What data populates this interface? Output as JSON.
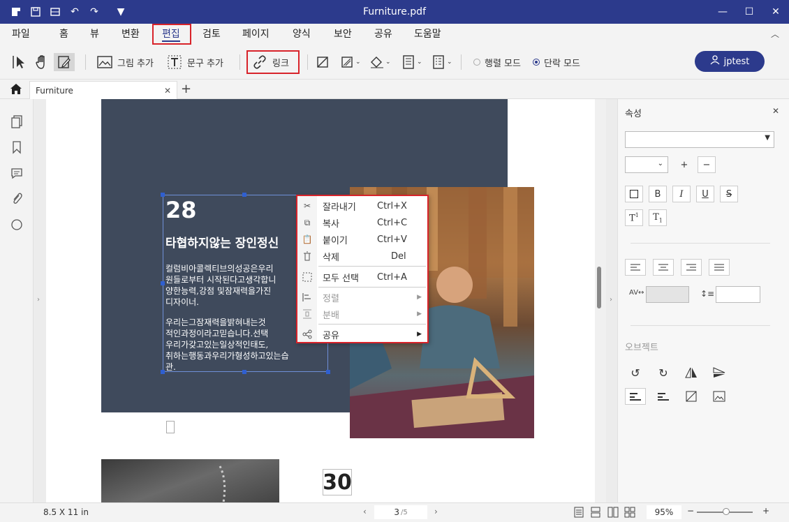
{
  "window": {
    "title": "Furniture.pdf"
  },
  "menu": [
    "파일",
    "홈",
    "뷰",
    "변환",
    "편집",
    "검토",
    "페이지",
    "양식",
    "보안",
    "공유",
    "도움말"
  ],
  "toolbar": {
    "add_image": "그림 추가",
    "add_text": "문구 추가",
    "link": "링크",
    "line_mode": "행렬 모드",
    "para_mode": "단락 모드",
    "user": "jptest"
  },
  "tab": {
    "name": "Furniture"
  },
  "doc": {
    "number1": "28",
    "heading": "타협하지않는 장인정신",
    "para1": [
      "컬럼비아콜렉티브의성공은우리",
      "원들로부터 시작된다고생각합니",
      "양한능력,강점 및잠재력을가진",
      "디자이너."
    ],
    "para2": [
      "우리는그잠재력을밝혀내는것",
      "적인과정이라고믿습니다.선택",
      "우리가갖고있는일상적인태도,",
      "취하는행동과우리가형성하고있는습",
      "관."
    ],
    "number2": "30"
  },
  "context_menu": [
    {
      "label": "잘라내기",
      "shortcut": "Ctrl+X",
      "icon": "scissors-icon"
    },
    {
      "label": "복사",
      "shortcut": "Ctrl+C",
      "icon": "copy-icon"
    },
    {
      "label": "붙이기",
      "shortcut": "Ctrl+V",
      "icon": "paste-icon"
    },
    {
      "label": "삭제",
      "shortcut": "Del",
      "icon": "trash-icon"
    },
    {
      "label": "모두 선택",
      "shortcut": "Ctrl+A",
      "icon": "select-all-icon"
    },
    {
      "label": "정렬",
      "shortcut": "",
      "icon": "align-icon"
    },
    {
      "label": "분배",
      "shortcut": "",
      "icon": "distribute-icon"
    },
    {
      "label": "공유",
      "shortcut": "",
      "icon": "share-icon"
    }
  ],
  "props": {
    "title": "속성",
    "object_title": "오브젝트"
  },
  "status": {
    "page_size": "8.5 X 11 in",
    "page_current": "3",
    "page_total": "/5",
    "zoom": "95%"
  },
  "colors": {
    "brand": "#2c3a8c",
    "highlight": "#d8232a",
    "page_dark": "#3f4a5c"
  }
}
